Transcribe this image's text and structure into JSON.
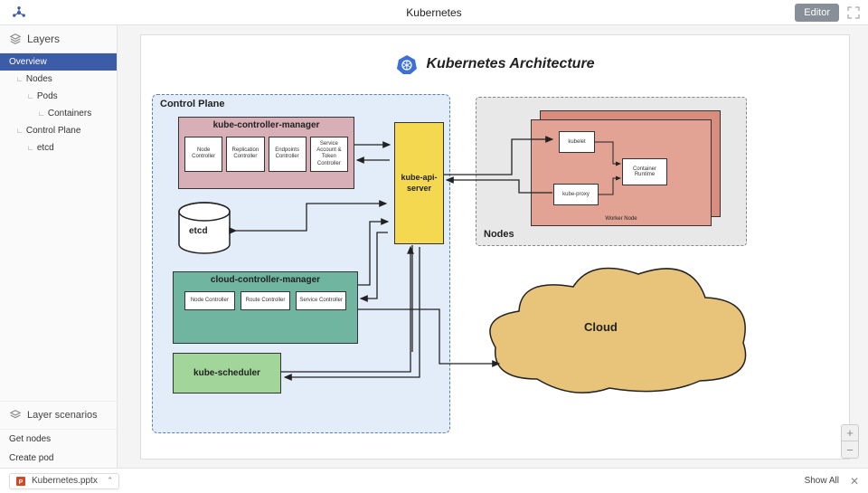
{
  "topbar": {
    "doc_title": "Kubernetes",
    "editor_button": "Editor"
  },
  "sidebar": {
    "layers_header": "Layers",
    "tree": {
      "overview": "Overview",
      "nodes": "Nodes",
      "pods": "Pods",
      "containers": "Containers",
      "control_plane": "Control Plane",
      "etcd": "etcd"
    },
    "scenarios_header": "Layer scenarios",
    "scenarios": {
      "get_nodes": "Get nodes",
      "create_pod": "Create pod"
    }
  },
  "diagram": {
    "title": "Kubernetes Architecture",
    "control_plane": {
      "label": "Control Plane",
      "kcm": {
        "title": "kube-controller-manager",
        "cells": [
          "Node Controller",
          "Replication Controller",
          "Endpoints Controller",
          "Service Account & Token Controller"
        ]
      },
      "etcd": "etcd",
      "ccm": {
        "title": "cloud-controller-manager",
        "cells": [
          "Node Controller",
          "Route Controller",
          "Service Controller"
        ]
      },
      "scheduler": "kube-scheduler",
      "api": "kube-api-server"
    },
    "nodes": {
      "label": "Nodes",
      "worker_label": "Worker Node",
      "kubelet": "kubelet",
      "kubeproxy": "kube-proxy",
      "runtime": "Container Runtime"
    },
    "cloud": {
      "label": "Cloud"
    }
  },
  "bottombar": {
    "download_file": "Kubernetes.pptx",
    "show_all": "Show All"
  },
  "colors": {
    "accent": "#3d5ca8",
    "control_plane_bg": "#e3ecf9",
    "kcm_bg": "#d8aeb7",
    "ccm_bg": "#6fb59f",
    "sched_bg": "#a1d59a",
    "api_bg": "#f3d850",
    "nodes_bg": "#e8e8e8",
    "worker_bg": "#e2a294",
    "cloud_fill": "#e8c47a"
  }
}
